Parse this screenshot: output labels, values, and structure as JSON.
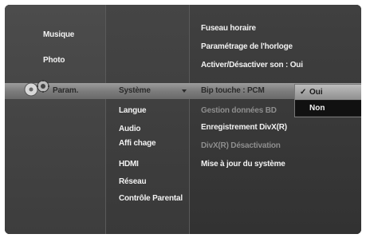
{
  "left_menu": {
    "items": [
      {
        "label": "Musique"
      },
      {
        "label": "Photo"
      },
      {
        "label": "Param."
      }
    ]
  },
  "middle_menu": {
    "items": [
      {
        "label": "Système"
      },
      {
        "label": "Langue"
      },
      {
        "label": "Audio"
      },
      {
        "label": "Affi chage"
      },
      {
        "label": "HDMI"
      },
      {
        "label": "Réseau"
      },
      {
        "label": "Contrôle Parental"
      }
    ]
  },
  "right_menu": {
    "items": [
      {
        "label": "Fuseau horaire"
      },
      {
        "label": "Paramétrage de l'horloge"
      },
      {
        "label": "Activer/Désactiver son  :  Oui"
      },
      {
        "label": "Bip touche  :  PCM"
      },
      {
        "label": "Gestion données BD"
      },
      {
        "label": "Enregistrement DivX(R)"
      },
      {
        "label": "DivX(R) Désactivation"
      },
      {
        "label": "Mise à jour du système"
      }
    ]
  },
  "popup": {
    "options": [
      {
        "label": "Oui",
        "check": "✓"
      },
      {
        "label": "Non"
      }
    ]
  },
  "icons": {
    "settings": "gear-disc-icon",
    "arrow": "triangle-down-icon"
  }
}
